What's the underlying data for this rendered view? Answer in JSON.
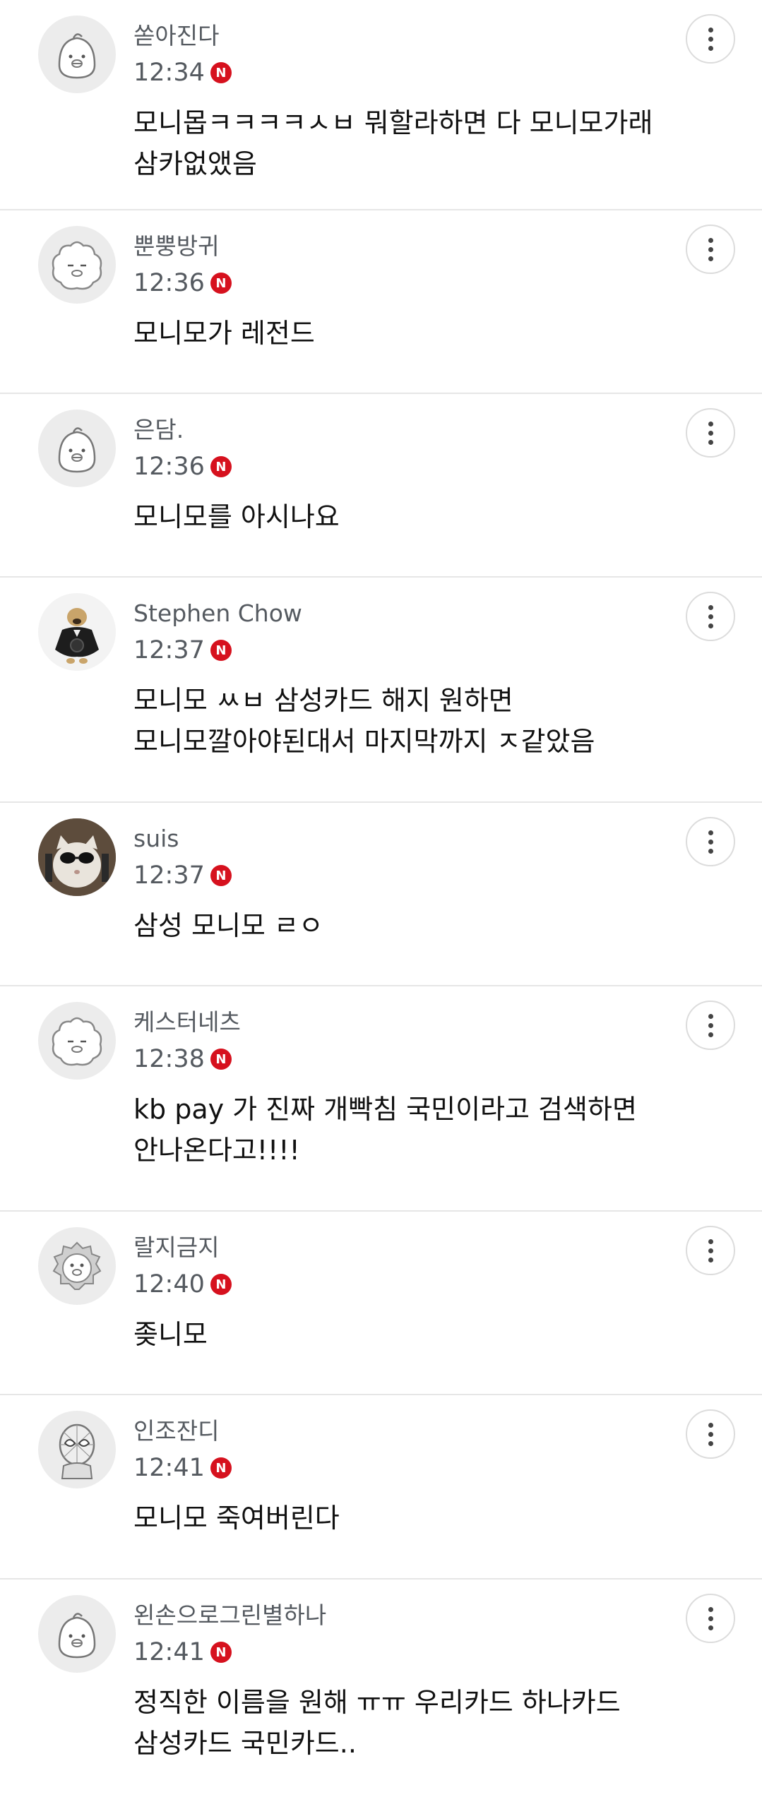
{
  "comments": [
    {
      "name": "쏟아진다",
      "time": "12:34",
      "badge": "N",
      "text": "모니몹ㅋㅋㅋㅋㅅㅂ 뭐할라하면 다 모니모가래\n삼카없앴음",
      "avatar": "chick-icon"
    },
    {
      "name": "뿐뿡방귀",
      "time": "12:36",
      "badge": "N",
      "text": "모니모가 레전드",
      "avatar": "sheep-icon"
    },
    {
      "name": "은담.",
      "time": "12:36",
      "badge": "N",
      "text": "모니모를 아시나요",
      "avatar": "chick-icon"
    },
    {
      "name": "Stephen Chow",
      "time": "12:37",
      "badge": "N",
      "text": "모니모 ㅆㅂ 삼성카드 해지 원하면\n모니모깔아야된대서 마지막까지 ㅈ같았음",
      "avatar": "dog-photo"
    },
    {
      "name": "suis",
      "time": "12:37",
      "badge": "N",
      "text": "삼성 모니모 ㄹㅇ",
      "avatar": "cat-photo"
    },
    {
      "name": "케스터네츠",
      "time": "12:38",
      "badge": "N",
      "text": "kb pay 가 진짜 개빡침 국민이라고 검색하면\n안나온다고!!!!",
      "avatar": "sheep-icon"
    },
    {
      "name": "랄지금지",
      "time": "12:40",
      "badge": "N",
      "text": "좆니모",
      "avatar": "lion-icon"
    },
    {
      "name": "인조잔디",
      "time": "12:41",
      "badge": "N",
      "text": "모니모 죽여버린다",
      "avatar": "spiderman-icon"
    },
    {
      "name": "왼손으로그린별하나",
      "time": "12:41",
      "badge": "N",
      "text": "정직한 이름을 원해 ㅠㅠ 우리카드 하나카드\n삼성카드 국민카드..",
      "avatar": "chick-icon"
    }
  ],
  "colors": {
    "badge": "#d6111e",
    "meta": "#555a60",
    "divider": "#e6e6e6"
  }
}
